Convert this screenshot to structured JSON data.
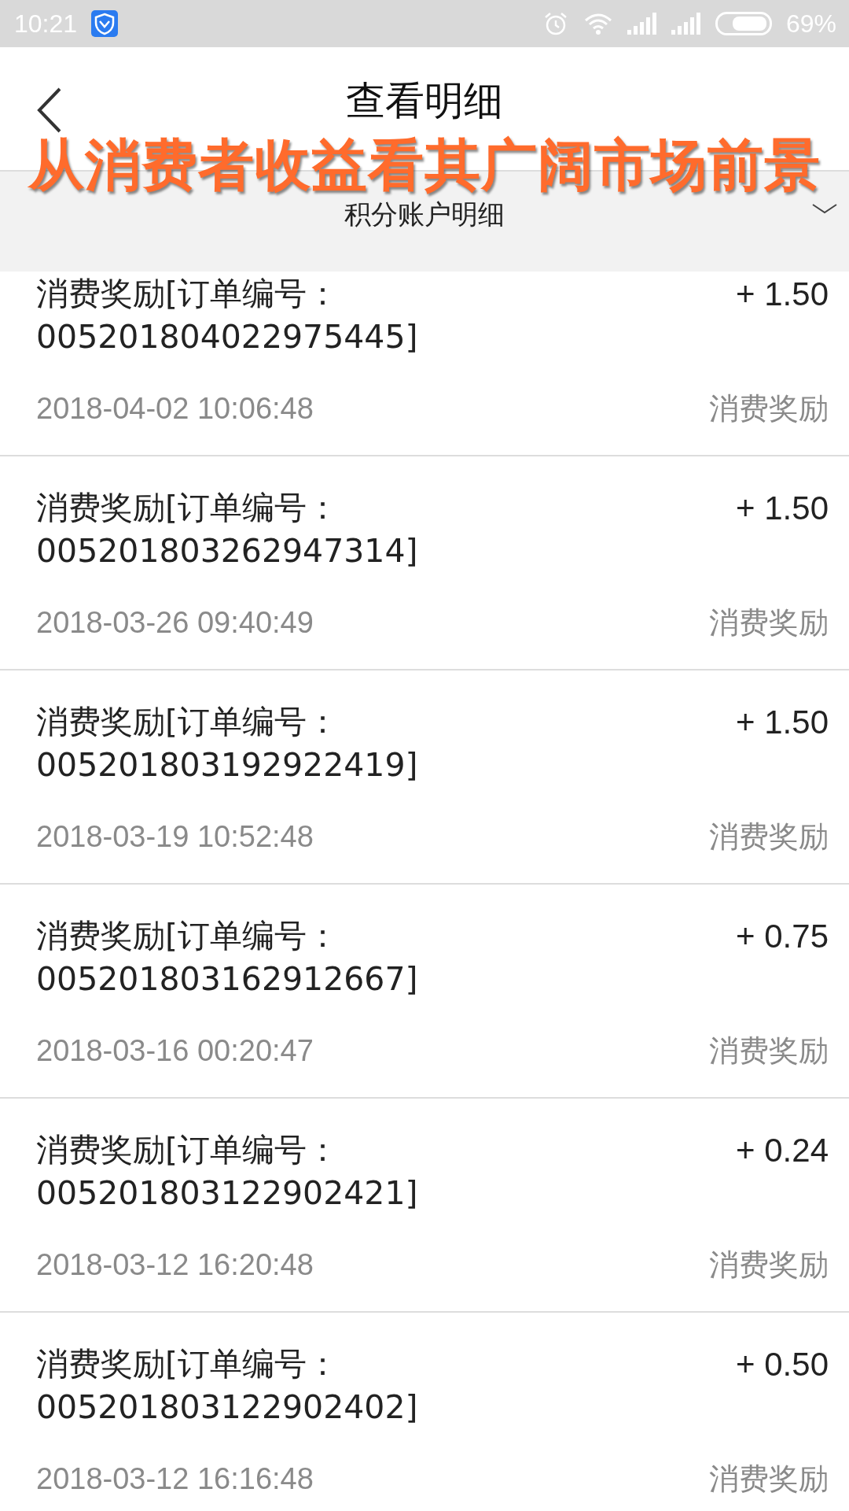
{
  "status_bar": {
    "time": "10:21",
    "battery_percent": "69%"
  },
  "header": {
    "title": "查看明细"
  },
  "overlay_caption": "从消费者收益看其广阔市场前景",
  "filter": {
    "label": "积分账户明细",
    "expanded": false
  },
  "records": [
    {
      "title": "消费奖励[订单编号：005201804022975445]",
      "amount": "+ 1.50",
      "time": "2018-04-02 10:06:48",
      "type": "消费奖励"
    },
    {
      "title": "消费奖励[订单编号：005201803262947314]",
      "amount": "+ 1.50",
      "time": "2018-03-26 09:40:49",
      "type": "消费奖励"
    },
    {
      "title": "消费奖励[订单编号：005201803192922419]",
      "amount": "+ 1.50",
      "time": "2018-03-19 10:52:48",
      "type": "消费奖励"
    },
    {
      "title": "消费奖励[订单编号：005201803162912667]",
      "amount": "+ 0.75",
      "time": "2018-03-16 00:20:47",
      "type": "消费奖励"
    },
    {
      "title": "消费奖励[订单编号：005201803122902421]",
      "amount": "+ 0.24",
      "time": "2018-03-12 16:20:48",
      "type": "消费奖励"
    },
    {
      "title": "消费奖励[订单编号：005201803122902402]",
      "amount": "+ 0.50",
      "time": "2018-03-12 16:16:48",
      "type": "消费奖励"
    }
  ]
}
